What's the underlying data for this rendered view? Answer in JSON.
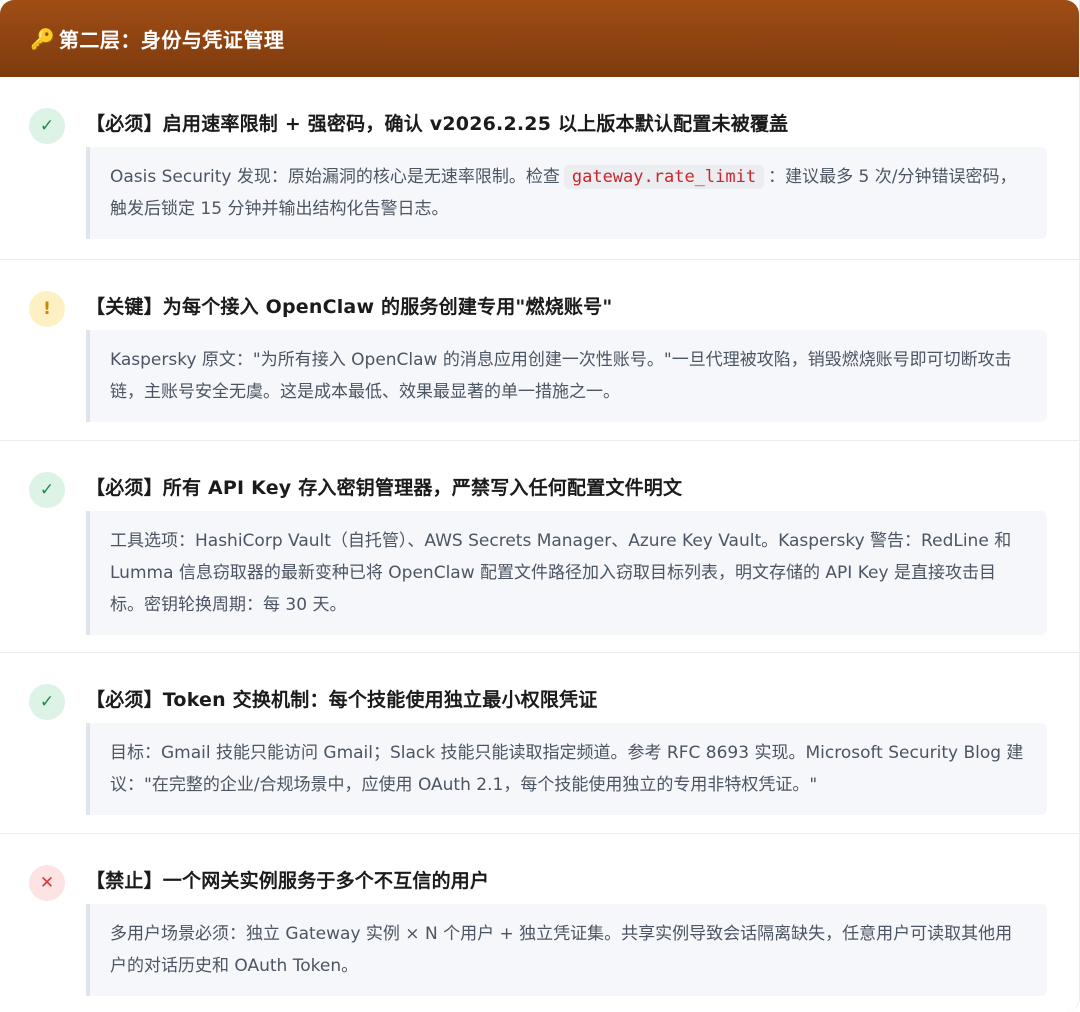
{
  "header": {
    "icon": "key-icon",
    "icon_glyph": "🔑",
    "title": "第二层：身份与凭证管理"
  },
  "items": [
    {
      "status": "ok",
      "badge_glyph": "✓",
      "title": "【必须】启用速率限制 + 强密码，确认 v2026.2.25 以上版本默认配置未被覆盖",
      "desc_before": "Oasis Security 发现：原始漏洞的核心是无速率限制。检查",
      "desc_code": "gateway.rate_limit",
      "desc_after": "：建议最多 5 次/分钟错误密码，触发后锁定 15 分钟并输出结构化告警日志。"
    },
    {
      "status": "warn",
      "badge_glyph": "!",
      "title": "【关键】为每个接入 OpenClaw 的服务创建专用\"燃烧账号\"",
      "desc": "Kaspersky 原文：\"为所有接入 OpenClaw 的消息应用创建一次性账号。\"一旦代理被攻陷，销毁燃烧账号即可切断攻击链，主账号安全无虞。这是成本最低、效果最显著的单一措施之一。"
    },
    {
      "status": "ok",
      "badge_glyph": "✓",
      "title": "【必须】所有 API Key 存入密钥管理器，严禁写入任何配置文件明文",
      "desc": "工具选项：HashiCorp Vault（自托管）、AWS Secrets Manager、Azure Key Vault。Kaspersky 警告：RedLine 和 Lumma 信息窃取器的最新变种已将 OpenClaw 配置文件路径加入窃取目标列表，明文存储的 API Key 是直接攻击目标。密钥轮换周期：每 30 天。"
    },
    {
      "status": "ok",
      "badge_glyph": "✓",
      "title": "【必须】Token 交换机制：每个技能使用独立最小权限凭证",
      "desc": "目标：Gmail 技能只能访问 Gmail；Slack 技能只能读取指定频道。参考 RFC 8693 实现。Microsoft Security Blog 建议：\"在完整的企业/合规场景中，应使用 OAuth 2.1，每个技能使用独立的专用非特权凭证。\""
    },
    {
      "status": "no",
      "badge_glyph": "✕",
      "title": "【禁止】一个网关实例服务于多个不互信的用户",
      "desc": "多用户场景必须：独立 Gateway 实例 × N 个用户 + 独立凭证集。共享实例导致会话隔离缺失，任意用户可读取其他用户的对话历史和 OAuth Token。"
    }
  ],
  "colors": {
    "header_top": "#a04d15",
    "header_bottom": "#7e3b0e",
    "ok": "#1f8a4a",
    "warn": "#c98a00",
    "no": "#d23a3a",
    "code": "#c8262c"
  }
}
